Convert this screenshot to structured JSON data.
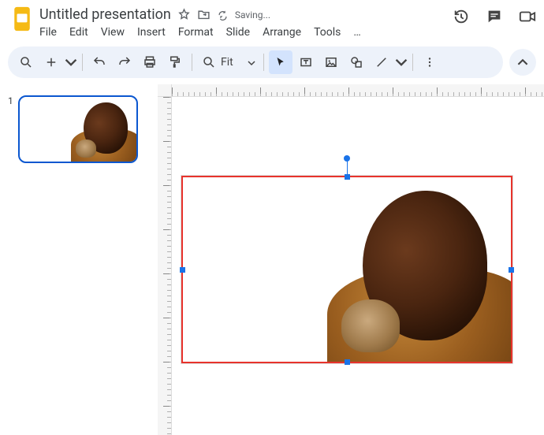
{
  "doc": {
    "title": "Untitled presentation",
    "status": "Saving..."
  },
  "menu": {
    "file": "File",
    "edit": "Edit",
    "view": "View",
    "insert": "Insert",
    "format": "Format",
    "slide": "Slide",
    "arrange": "Arrange",
    "tools": "Tools",
    "more": "…"
  },
  "toolbar": {
    "fit_label": "Fit"
  },
  "thumb": {
    "number": "1"
  },
  "canvas": {
    "selected_image": {
      "description": "Photograph: side profile of a young child in warm golden light holding a small meerkat, tan/ochre garment, white background on left side"
    },
    "selection": {
      "border_color": "#e8332c"
    }
  }
}
